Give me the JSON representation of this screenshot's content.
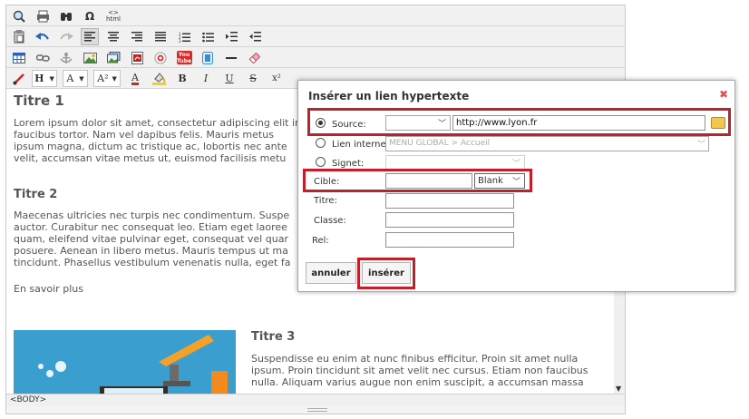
{
  "editor": {
    "toolbar_row1": [
      "preview-icon",
      "print-icon",
      "find-icon",
      "special-char-icon",
      "html-icon"
    ],
    "html_label": "html",
    "omega": "Ω",
    "format_labels": {
      "heading": "H",
      "font": "A",
      "fontsize": "A²",
      "fontcolor": "A",
      "bold": "B",
      "italic": "I",
      "underline": "U",
      "strike": "S",
      "sup": "x²"
    },
    "youtube_label": "You Tube",
    "content": {
      "title1": "Titre 1",
      "para1": "Lorem ipsum dolor sit amet, consectetur adipiscing elit in faucibus tortor. Nam vel dapibus felis. Mauris metus ipsum magna, dictum ac tristique ac, lobortis nec ante velit, accumsan vitae metus ut, euismod facilisis metu",
      "title2": "Titre 2",
      "para2": "Maecenas ultricies nec turpis nec condimentum. Suspe auctor. Curabitur nec consequat leo. Etiam eget laoree quam, eleifend vitae pulvinar eget, consequat vel quar posuere. Aenean in libero metus. Mauris tempus ut ma tincidunt. Phasellus vestibulum venenatis nulla, eget fa",
      "more": "En savoir plus",
      "title3": "Titre 3",
      "para3": "Suspendisse eu enim at nunc finibus efficitur. Proin sit amet nulla ipsum. Proin tincidunt sit amet velit nec cursus. Etiam non faucibus nulla. Aliquam varius augue non enim suscipit, a accumsan massa"
    },
    "path_bar": "<BODY>"
  },
  "dialog": {
    "title": "Insérer un lien hypertexte",
    "source_label": "Source:",
    "source_url": "http://www.lyon.fr",
    "internal_label": "Lien interne:",
    "internal_value": "MENU GLOBAL > Accueil",
    "signet_label": "Signet:",
    "cible_label": "Cible:",
    "cible_value": "Blank",
    "titre_label": "Titre:",
    "classe_label": "Classe:",
    "rel_label": "Rel:",
    "cancel_label": "annuler",
    "insert_label": "insérer",
    "highlight_color": "#c0202a"
  }
}
